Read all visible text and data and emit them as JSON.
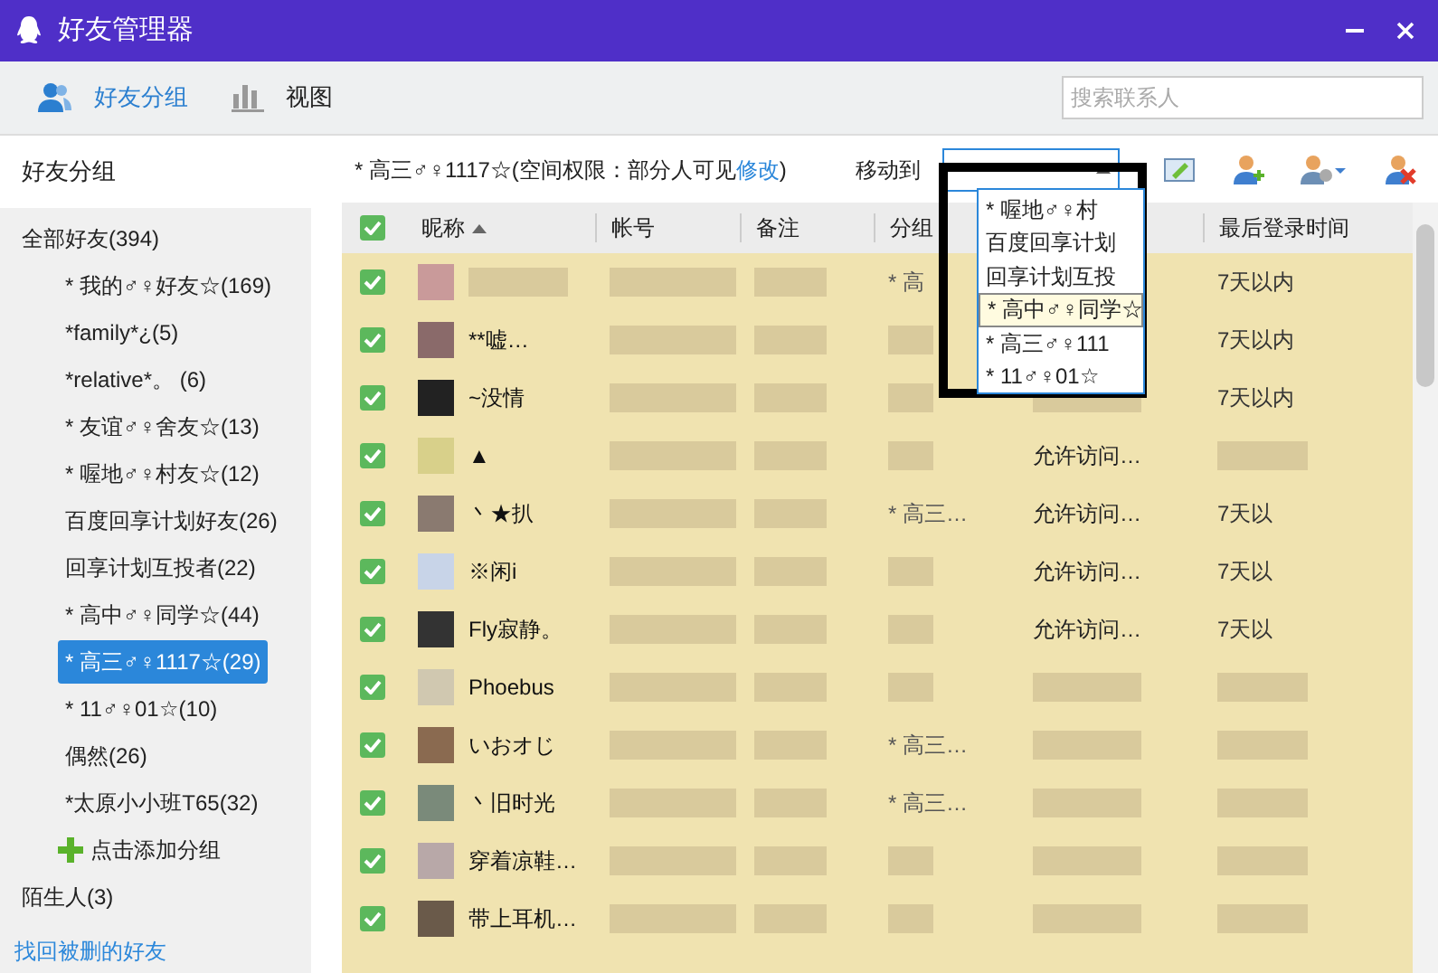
{
  "window": {
    "title": "好友管理器"
  },
  "toolbar": {
    "tabs": [
      {
        "label": "好友分组",
        "selected": true,
        "kind": "people"
      },
      {
        "label": "视图",
        "selected": false,
        "kind": "chart"
      }
    ],
    "search": {
      "placeholder": "搜索联系人"
    }
  },
  "sidebar": {
    "heading": "好友分组",
    "items": [
      {
        "label": "全部好友(394)",
        "selected": false,
        "children": [
          {
            "label": "* 我的♂♀好友☆(169)",
            "selected": false
          },
          {
            "label": "*family*¿(5)",
            "selected": false
          },
          {
            "label": "*relative*。 (6)",
            "selected": false
          },
          {
            "label": "* 友谊♂♀舍友☆(13)",
            "selected": false
          },
          {
            "label": "* 喔地♂♀村友☆(12)",
            "selected": false
          },
          {
            "label": "百度回享计划好友(26)",
            "selected": false
          },
          {
            "label": "回享计划互投者(22)",
            "selected": false
          },
          {
            "label": "* 高中♂♀同学☆(44)",
            "selected": false
          },
          {
            "label": "* 高三♂♀1117☆(29)",
            "selected": true
          },
          {
            "label": "* 11♂♀01☆(10)",
            "selected": false
          },
          {
            "label": "偶然(26)",
            "selected": false
          },
          {
            "label": "*太原小小班T65(32)",
            "selected": false
          }
        ]
      }
    ],
    "add_group": "点击添加分组",
    "strangers": "陌生人(3)",
    "recover_link": "找回被删的好友"
  },
  "group_header": {
    "text": "* 高三♂♀1117☆(空间权限：部分人可见",
    "link": "修改",
    "close": ")"
  },
  "move_to": {
    "label": "移动到",
    "dropdown_items": [
      {
        "label": "* 喔地♂♀村",
        "selected": false
      },
      {
        "label": "百度回享计划",
        "selected": false
      },
      {
        "label": "回享计划互投",
        "selected": false
      },
      {
        "label": "* 高中♂♀同学☆",
        "selected": true
      },
      {
        "label": "* 高三♂♀111",
        "selected": false
      },
      {
        "label": "* 11♂♀01☆",
        "selected": false
      }
    ]
  },
  "table": {
    "all_checked": true,
    "columns": [
      "昵称",
      "帐号",
      "备注",
      "分组",
      "最后登录时间"
    ],
    "rows": [
      {
        "checked": true,
        "nickname": "",
        "group": "* 高",
        "permission": "",
        "last_login": "7天以内"
      },
      {
        "checked": true,
        "nickname": "**嘘…",
        "group": "",
        "permission": "",
        "last_login": "7天以内"
      },
      {
        "checked": true,
        "nickname": "~没情",
        "group": "",
        "permission": "",
        "last_login": "7天以内"
      },
      {
        "checked": true,
        "nickname": "▲",
        "group": "",
        "permission": "允许访问…",
        "last_login": ""
      },
      {
        "checked": true,
        "nickname": "丶★扒",
        "group": "* 高三…",
        "permission": "允许访问…",
        "last_login": "7天以"
      },
      {
        "checked": true,
        "nickname": "※闲i",
        "group": "",
        "permission": "允许访问…",
        "last_login": "7天以"
      },
      {
        "checked": true,
        "nickname": "Fly寂静。",
        "group": "",
        "permission": "允许访问…",
        "last_login": "7天以"
      },
      {
        "checked": true,
        "nickname": "Phoebus",
        "group": "",
        "permission": "",
        "last_login": ""
      },
      {
        "checked": true,
        "nickname": "いおオじ",
        "group": "* 高三…",
        "permission": "",
        "last_login": ""
      },
      {
        "checked": true,
        "nickname": "丶旧时光",
        "group": "* 高三…",
        "permission": "",
        "last_login": ""
      },
      {
        "checked": true,
        "nickname": "穿着凉鞋…",
        "group": "",
        "permission": "",
        "last_login": ""
      },
      {
        "checked": true,
        "nickname": "带上耳机…",
        "group": "",
        "permission": "",
        "last_login": ""
      }
    ]
  }
}
